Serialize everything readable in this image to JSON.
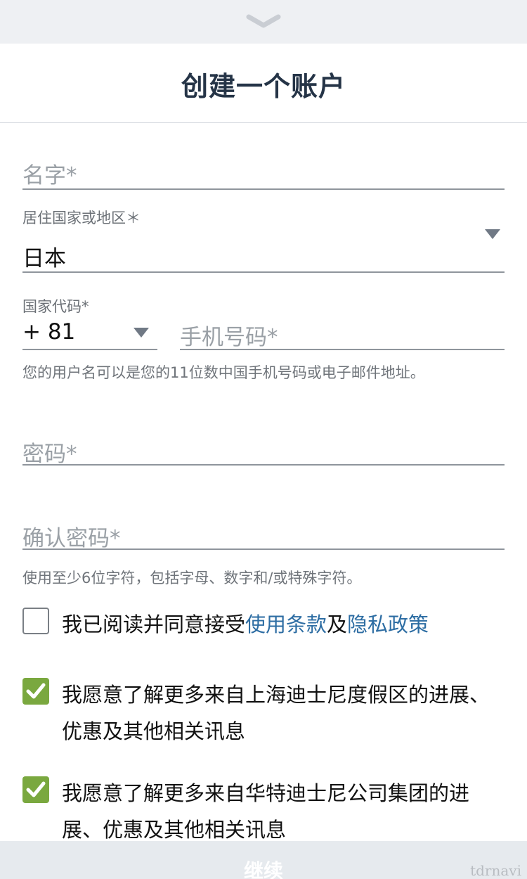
{
  "header": {
    "title": "创建一个账户"
  },
  "form": {
    "name": {
      "placeholder": "名字*"
    },
    "country": {
      "label": "居住国家或地区＊",
      "value": "日本"
    },
    "country_code": {
      "label": "国家代码*",
      "value": "+ 81"
    },
    "phone": {
      "placeholder": "手机号码*"
    },
    "username_helper": "您的用户名可以是您的11位数中国手机号码或电子邮件地址。",
    "password": {
      "placeholder": "密码*"
    },
    "confirm_password": {
      "placeholder": "确认密码*"
    },
    "password_helper": "使用至少6位字符，包括字母、数字和/或特殊字符。"
  },
  "consents": {
    "terms": {
      "checked": false,
      "prefix": "我已阅读并同意接受",
      "terms_link": "使用条款",
      "connector": "及",
      "privacy_link": "隐私政策"
    },
    "shanghai_marketing": {
      "checked": true,
      "text": "我愿意了解更多来自上海迪士尼度假区的进展、优惠及其他相关讯息"
    },
    "disney_marketing": {
      "checked": true,
      "text": "我愿意了解更多来自华特迪士尼公司集团的进展、优惠及其他相关讯息"
    }
  },
  "footer": {
    "continue_label": "继续"
  },
  "watermark": "tdrnavi",
  "colors": {
    "title": "#253447",
    "link": "#2d6da3",
    "checkbox_checked": "#7aa83f",
    "top_strip": "#eef0f3"
  },
  "icons": {
    "collapse": "chevron-down-icon",
    "dropdown": "caret-down-icon",
    "check": "check-icon"
  }
}
